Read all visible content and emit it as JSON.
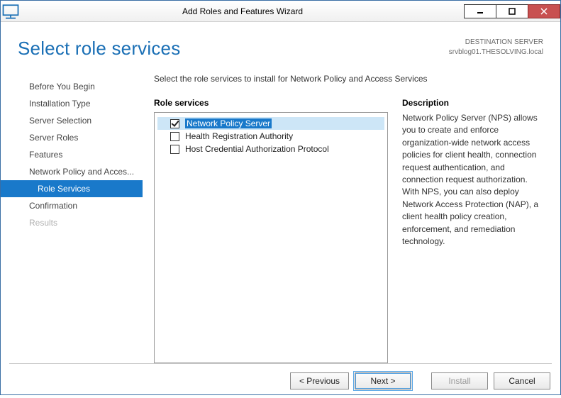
{
  "window": {
    "title": "Add Roles and Features Wizard"
  },
  "header": {
    "title": "Select role services",
    "destination_label": "DESTINATION SERVER",
    "destination_value": "srvblog01.THESOLVING.local"
  },
  "nav": {
    "items": [
      "Before You Begin",
      "Installation Type",
      "Server Selection",
      "Server Roles",
      "Features",
      "Network Policy and Acces...",
      "Role Services",
      "Confirmation",
      "Results"
    ],
    "selected_index": 6,
    "disabled_indices": [
      8
    ],
    "sub_indices": [
      6
    ]
  },
  "main": {
    "instruction": "Select the role services to install for Network Policy and Access Services",
    "list_header": "Role services",
    "desc_header": "Description",
    "desc_text": "Network Policy Server (NPS) allows you to create and enforce organization-wide network access policies for client health, connection request authentication, and connection request authorization. With NPS, you can also deploy Network Access Protection (NAP), a client health policy creation, enforcement, and remediation technology.",
    "items": [
      {
        "label": "Network Policy Server",
        "checked": true,
        "selected": true
      },
      {
        "label": "Health Registration Authority",
        "checked": false,
        "selected": false
      },
      {
        "label": "Host Credential Authorization Protocol",
        "checked": false,
        "selected": false
      }
    ]
  },
  "footer": {
    "previous": "< Previous",
    "next": "Next >",
    "install": "Install",
    "cancel": "Cancel"
  }
}
